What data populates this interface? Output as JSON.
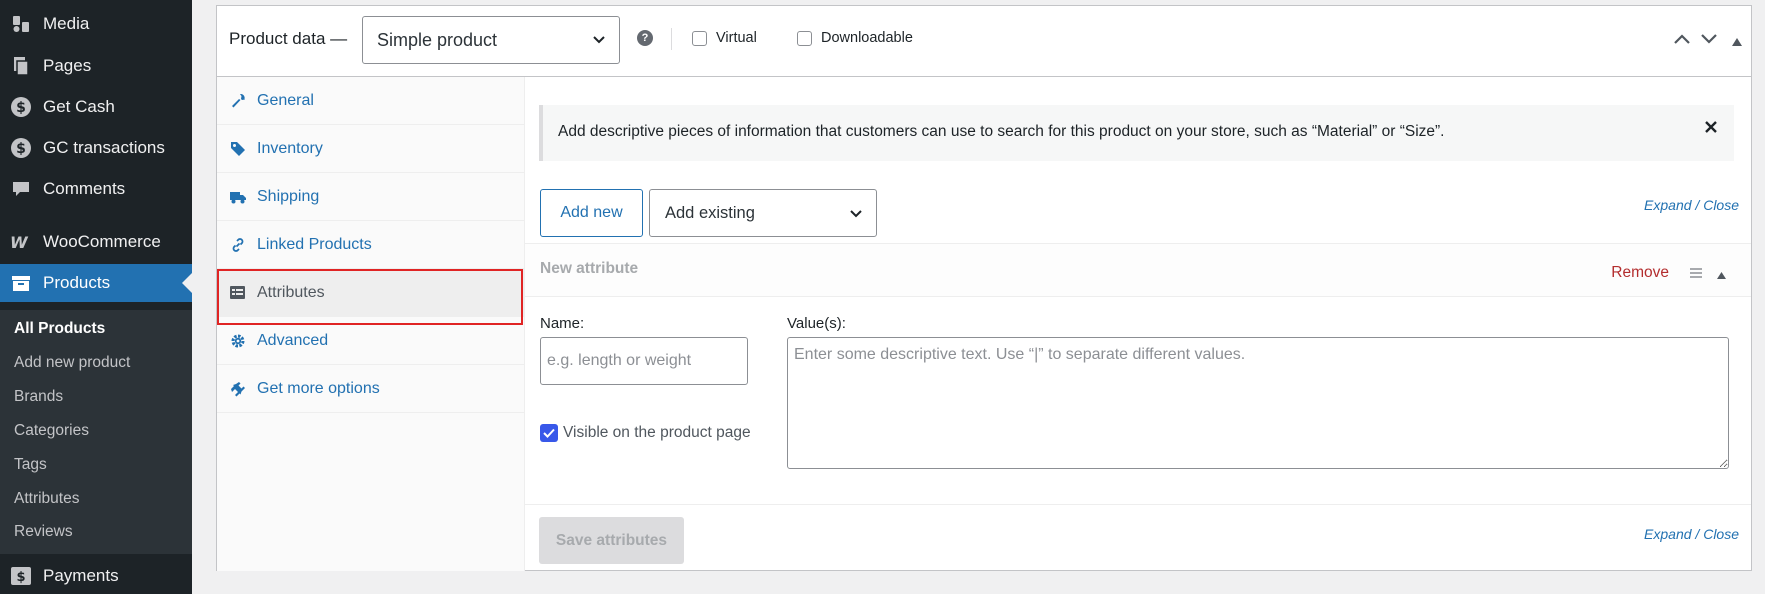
{
  "sidebar": {
    "menu": [
      {
        "label": "Media",
        "icon": "media-icon"
      },
      {
        "label": "Pages",
        "icon": "pages-icon"
      },
      {
        "label": "Get Cash",
        "icon": "dollar-icon"
      },
      {
        "label": "GC transactions",
        "icon": "dollar-icon"
      },
      {
        "label": "Comments",
        "icon": "comment-icon"
      },
      {
        "label": "WooCommerce",
        "icon": "woocommerce-icon"
      },
      {
        "label": "Products",
        "icon": "archive-icon",
        "active": true
      },
      {
        "label": "Payments",
        "icon": "payments-icon"
      }
    ],
    "submenu": [
      {
        "label": "All Products",
        "current": true
      },
      {
        "label": "Add new product"
      },
      {
        "label": "Brands"
      },
      {
        "label": "Categories"
      },
      {
        "label": "Tags"
      },
      {
        "label": "Attributes"
      },
      {
        "label": "Reviews"
      }
    ]
  },
  "panel": {
    "title": "Product data —",
    "product_type": "Simple product",
    "virtual_label": "Virtual",
    "downloadable_label": "Downloadable",
    "virtual_checked": false,
    "downloadable_checked": false
  },
  "tabs": [
    {
      "label": "General",
      "icon": "wrench-icon"
    },
    {
      "label": "Inventory",
      "icon": "tag-icon"
    },
    {
      "label": "Shipping",
      "icon": "truck-icon"
    },
    {
      "label": "Linked Products",
      "icon": "link-icon"
    },
    {
      "label": "Attributes",
      "icon": "list-icon",
      "active": true
    },
    {
      "label": "Advanced",
      "icon": "gear-icon"
    },
    {
      "label": "Get more options",
      "icon": "plugin-icon"
    }
  ],
  "attributes": {
    "notice": "Add descriptive pieces of information that customers can use to search for this product on your store, such as “Material” or “Size”.",
    "add_new": "Add new",
    "add_existing": "Add existing",
    "expand": "Expand",
    "separator": "/",
    "close": "Close",
    "attribute_title": "New attribute",
    "remove": "Remove",
    "name_label": "Name:",
    "name_placeholder": "e.g. length or weight",
    "values_label": "Value(s):",
    "values_placeholder": "Enter some descriptive text. Use “|” to separate different values.",
    "visible_label": "Visible on the product page",
    "visible_checked": true,
    "save": "Save attributes"
  },
  "colors": {
    "accent": "#2271b1",
    "admin_bar": "#1d2327",
    "highlight": "#e02424",
    "remove": "#b32d2e"
  }
}
